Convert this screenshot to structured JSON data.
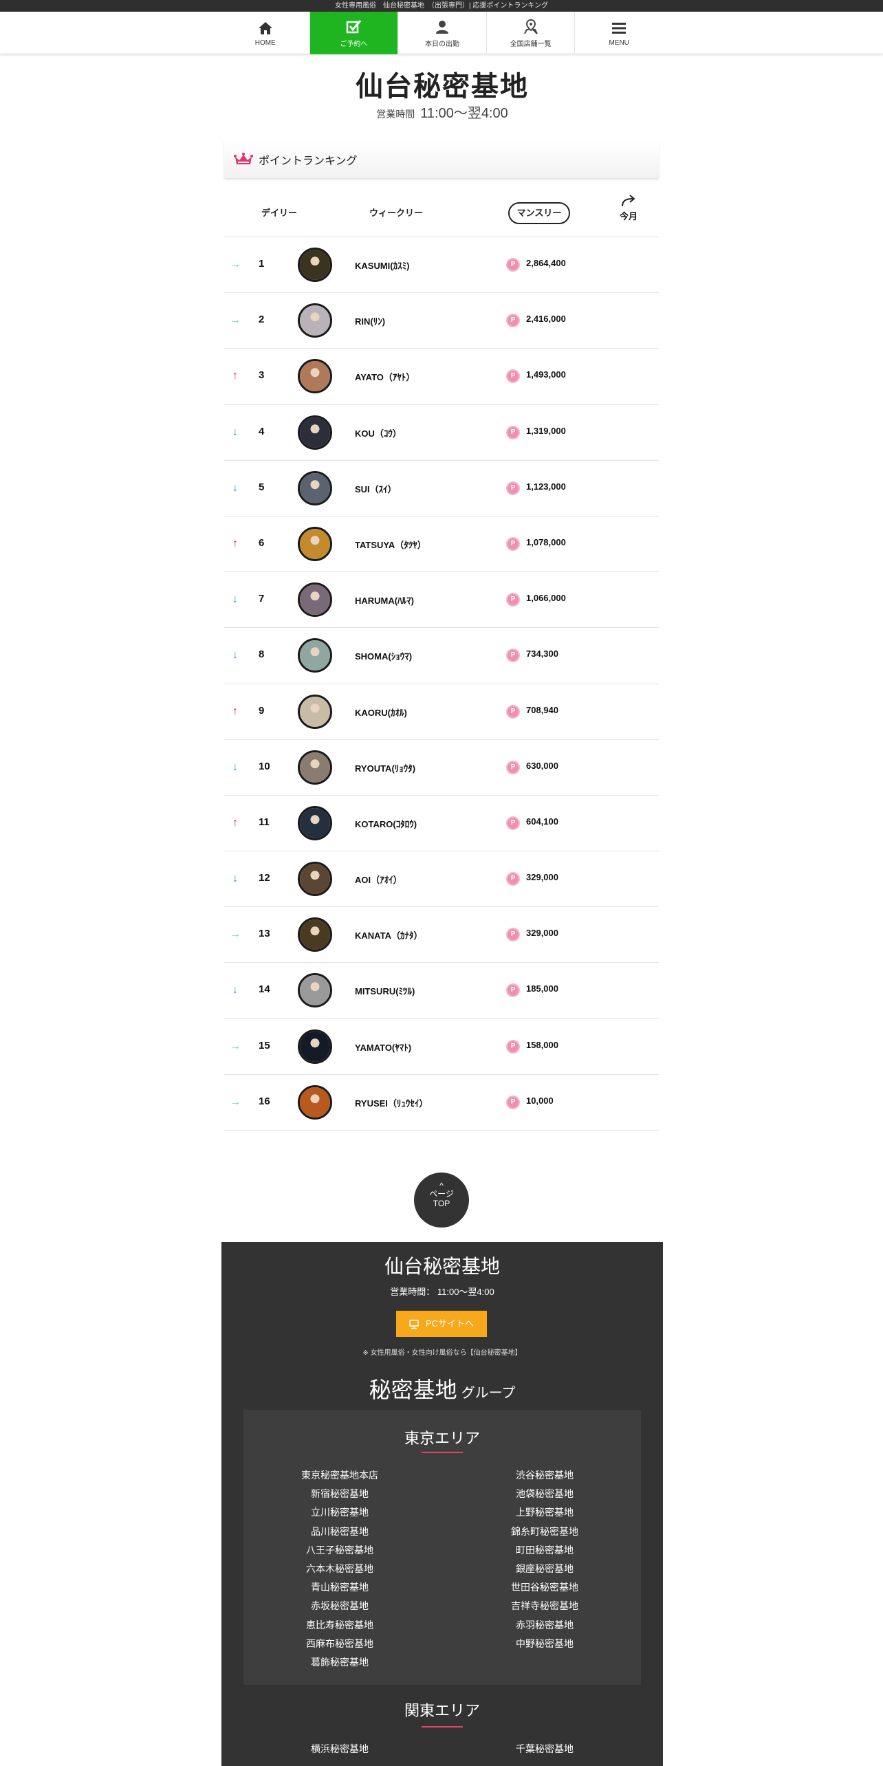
{
  "topbar": {
    "text": "女性専用風俗　仙台秘密基地　（出張専門）| 応援ポイントランキング"
  },
  "nav": {
    "items": [
      {
        "label": "HOME",
        "icon": "home-icon"
      },
      {
        "label": "ご予約へ",
        "icon": "check-icon"
      },
      {
        "label": "本日の出勤",
        "icon": "person-icon"
      },
      {
        "label": "全国店舗一覧",
        "icon": "map-pin-icon"
      },
      {
        "label": "MENU",
        "icon": "hamburger-icon"
      }
    ],
    "active_color": "#1fb520"
  },
  "header": {
    "shop_name": "仙台秘密基地",
    "hours_label": "営業時間",
    "hours_value": "11:00〜翌4:00"
  },
  "ranking": {
    "title": "ポイントランキング",
    "crown_color": "#e8336d",
    "tabs": {
      "daily": "デイリー",
      "weekly": "ウィークリー",
      "monthly": "マンスリー",
      "this_month": "今月"
    },
    "rows": [
      {
        "rank": "1",
        "trend": "same",
        "name": "KASUMI(ｶｽﾐ)",
        "points": "2,864,400",
        "avatar": "#3a3320"
      },
      {
        "rank": "2",
        "trend": "same",
        "name": "RIN(ﾘﾝ)",
        "points": "2,416,000",
        "avatar": "#b9b2b8"
      },
      {
        "rank": "3",
        "trend": "up",
        "name": "AYATO（ｱﾔﾄ）",
        "points": "1,493,000",
        "avatar": "#b07a5a"
      },
      {
        "rank": "4",
        "trend": "down",
        "name": "KOU（ｺｳ）",
        "points": "1,319,000",
        "avatar": "#2c2f3a"
      },
      {
        "rank": "5",
        "trend": "down",
        "name": "SUI（ｽｲ）",
        "points": "1,123,000",
        "avatar": "#5b6270"
      },
      {
        "rank": "6",
        "trend": "up",
        "name": "TATSUYA（ﾀﾂﾔ）",
        "points": "1,078,000",
        "avatar": "#c38a2e"
      },
      {
        "rank": "7",
        "trend": "down",
        "name": "HARUMA(ﾊﾙﾏ)",
        "points": "1,066,000",
        "avatar": "#7a6a78"
      },
      {
        "rank": "8",
        "trend": "down",
        "name": "SHOMA(ｼｮｳﾏ)",
        "points": "734,300",
        "avatar": "#8fa7a0"
      },
      {
        "rank": "9",
        "trend": "up",
        "name": "KAORU(ｶｵﾙ)",
        "points": "708,940",
        "avatar": "#c9bca6"
      },
      {
        "rank": "10",
        "trend": "down",
        "name": "RYOUTA(ﾘｮｳﾀ)",
        "points": "630,000",
        "avatar": "#8a7d70"
      },
      {
        "rank": "11",
        "trend": "up",
        "name": "KOTARO(ｺﾀﾛｳ)",
        "points": "604,100",
        "avatar": "#243040"
      },
      {
        "rank": "12",
        "trend": "down",
        "name": "AOI（ｱｵｲ）",
        "points": "329,000",
        "avatar": "#5a4632"
      },
      {
        "rank": "13",
        "trend": "same",
        "name": "KANATA（ｶﾅﾀ）",
        "points": "329,000",
        "avatar": "#4a3a22"
      },
      {
        "rank": "14",
        "trend": "down",
        "name": "MITSURU(ﾐﾂﾙ)",
        "points": "185,000",
        "avatar": "#9a9a9a"
      },
      {
        "rank": "15",
        "trend": "same",
        "name": "YAMATO(ﾔﾏﾄ)",
        "points": "158,000",
        "avatar": "#151a28"
      },
      {
        "rank": "16",
        "trend": "same",
        "name": "RYUSEI（ﾘｭｳｾｲ）",
        "points": "10,000",
        "avatar": "#b85a1e"
      }
    ]
  },
  "page_top": {
    "line1": "ページ",
    "line2": "TOP"
  },
  "footer": {
    "shop_name": "仙台秘密基地",
    "hours": "営業時間：  11:00～翌4:00",
    "pc_button": "PCサイトへ",
    "note": "※ 女性用風俗・女性向け風俗なら【仙台秘密基地】",
    "group_big": "秘密基地",
    "group_small": "グループ",
    "areas": [
      {
        "title": "東京エリア",
        "left": [
          "東京秘密基地本店",
          "新宿秘密基地",
          "立川秘密基地",
          "品川秘密基地",
          "八王子秘密基地",
          "六本木秘密基地",
          "青山秘密基地",
          "赤坂秘密基地",
          "恵比寿秘密基地",
          "西麻布秘密基地",
          "葛飾秘密基地"
        ],
        "right": [
          "渋谷秘密基地",
          "池袋秘密基地",
          "上野秘密基地",
          "錦糸町秘密基地",
          "町田秘密基地",
          "銀座秘密基地",
          "世田谷秘密基地",
          "吉祥寺秘密基地",
          "赤羽秘密基地",
          "中野秘密基地"
        ]
      },
      {
        "title": "関東エリア",
        "left": [
          "横浜秘密基地"
        ],
        "right": [
          "千葉秘密基地"
        ]
      }
    ]
  }
}
